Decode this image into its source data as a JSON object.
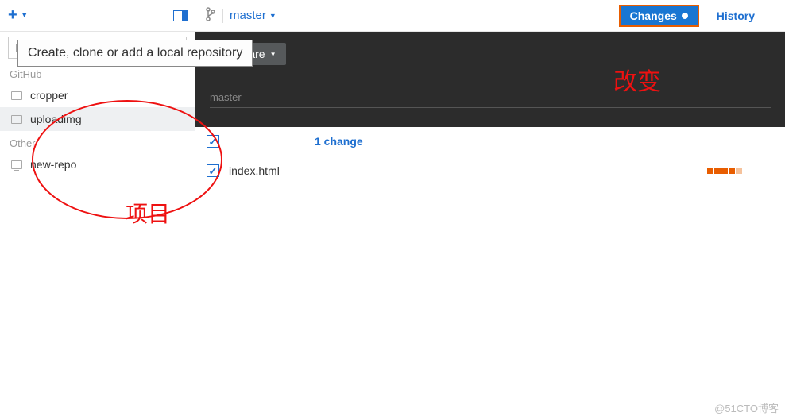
{
  "topbar": {
    "tooltip": "Create, clone or add a local repository",
    "branch": "master",
    "tabs": {
      "changes": "Changes",
      "history": "History"
    }
  },
  "sidebar": {
    "filter_placeholder": "Filter repositories",
    "sections": {
      "github": {
        "label": "GitHub",
        "items": [
          "cropper",
          "uploadimg"
        ]
      },
      "other": {
        "label": "Other",
        "items": [
          "new-repo"
        ]
      }
    }
  },
  "darkbar": {
    "compare": "Compare",
    "branch_label": "master"
  },
  "changes": {
    "count_label": "1 change",
    "files": [
      {
        "name": "index.html"
      }
    ]
  },
  "annotations": {
    "project": "项目",
    "change": "改变"
  },
  "watermark": "@51CTO博客"
}
